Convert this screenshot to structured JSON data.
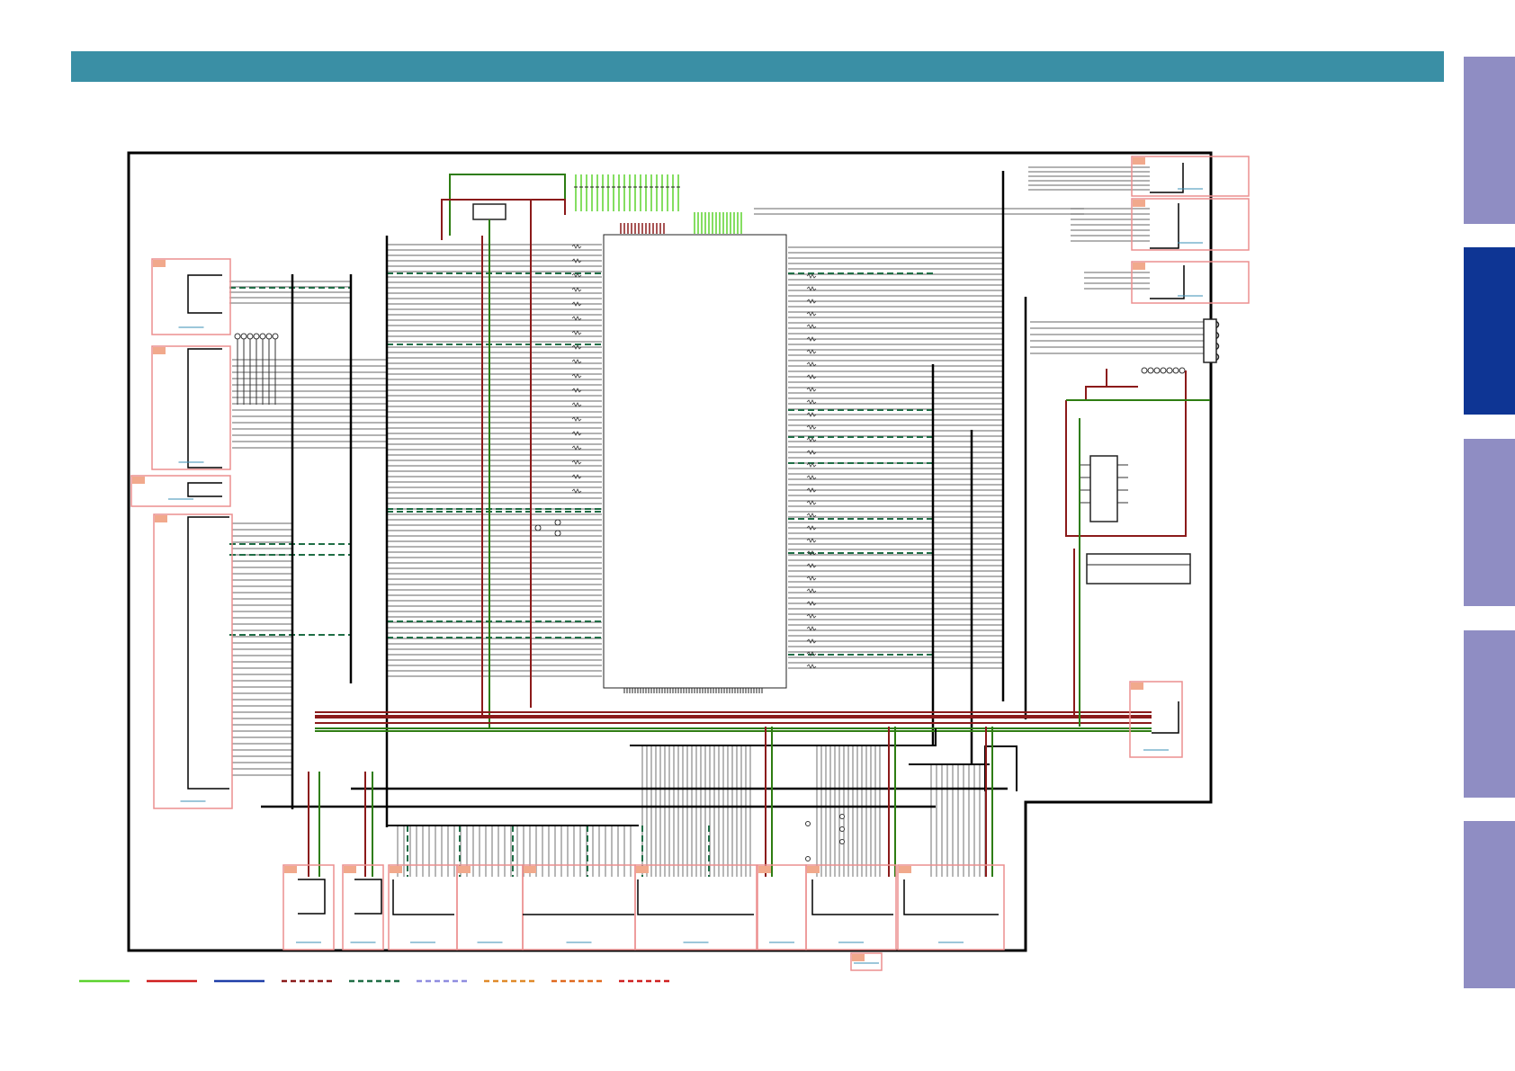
{
  "header": {
    "color": "#3a8fa5"
  },
  "side_tabs": [
    {
      "id": "tab-1",
      "color": "#8f8dc3",
      "active": false
    },
    {
      "id": "tab-2",
      "color": "#0e3594",
      "active": true
    },
    {
      "id": "tab-3",
      "color": "#8f8dc3",
      "active": false
    },
    {
      "id": "tab-4",
      "color": "#8f8dc3",
      "active": false
    },
    {
      "id": "tab-5",
      "color": "#8f8dc3",
      "active": false
    }
  ],
  "legend": [
    {
      "color": "#5cd32e",
      "style": "solid"
    },
    {
      "color": "#d02020",
      "style": "solid"
    },
    {
      "color": "#1f3fa8",
      "style": "solid"
    },
    {
      "color": "#8b1a1a",
      "style": "dashed"
    },
    {
      "color": "#1f6e46",
      "style": "dashed"
    },
    {
      "color": "#8f8de0",
      "style": "dashed"
    },
    {
      "color": "#e08a2a",
      "style": "dashed"
    },
    {
      "color": "#e06a20",
      "style": "dashed"
    },
    {
      "color": "#d02020",
      "style": "dashed"
    }
  ],
  "colors": {
    "board_outline": "#000000",
    "wire": "#333333",
    "bus_red": "#8b1a1a",
    "bus_green": "#2e7d12",
    "bus_light_green": "#5cd32e",
    "dashed_green": "#1f6e46",
    "connector_box": "#ec8f8f",
    "connector_tag": "#f1a98c",
    "connector_ref": "#3a8fb5"
  },
  "icons": {
    "resistor": "resistor-icon",
    "capacitor": "capacitor-icon",
    "pin": "pin-icon"
  }
}
